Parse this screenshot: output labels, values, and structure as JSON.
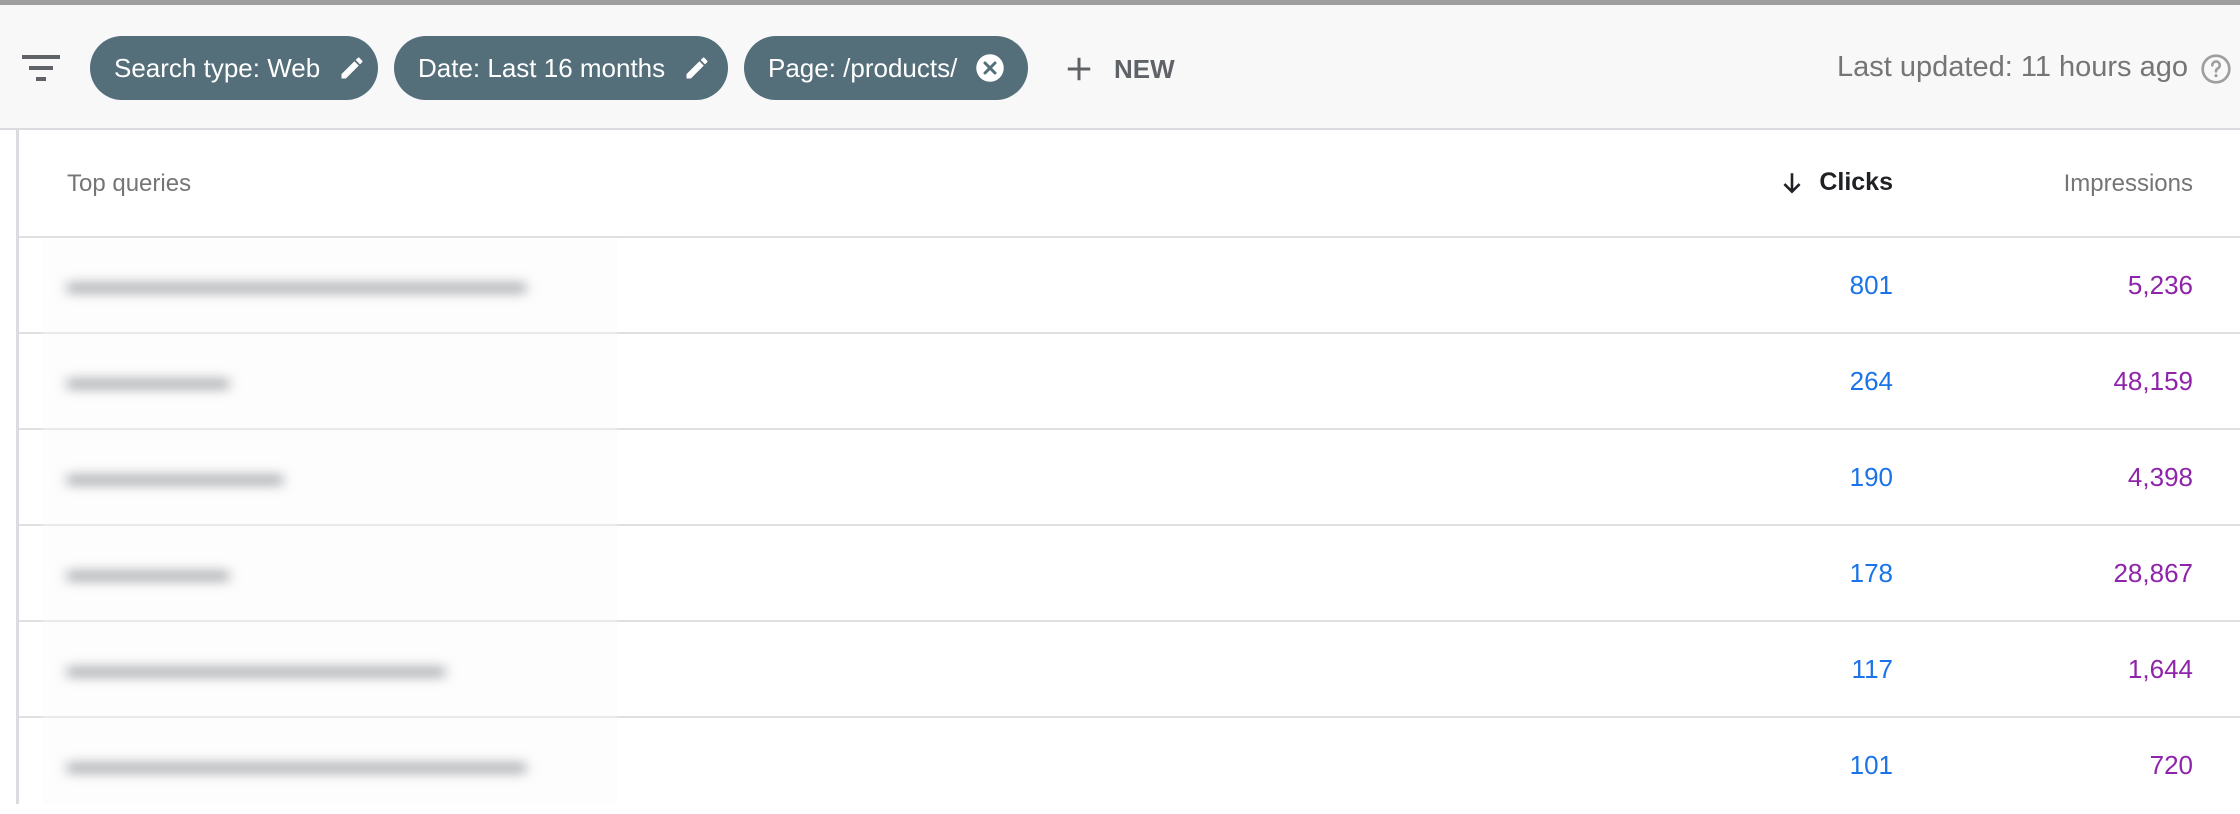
{
  "toolbar": {
    "filter_icon": "filter-list-icon",
    "chips": [
      {
        "label": "Search type: Web",
        "icon": "edit-pencil-icon"
      },
      {
        "label": "Date: Last 16 months",
        "icon": "edit-pencil-icon"
      },
      {
        "label": "Page: /products/",
        "icon": "close-circle-icon"
      }
    ],
    "new_label": "NEW",
    "new_icon": "plus-icon",
    "last_updated": "Last updated: 11 hours ago",
    "help_icon": "help-circle-icon"
  },
  "table": {
    "columns": {
      "query": "Top queries",
      "clicks": "Clicks",
      "impressions": "Impressions",
      "sort_icon": "arrow-down-icon"
    },
    "rows": [
      {
        "query": "",
        "clicks": "801",
        "impressions": "5,236"
      },
      {
        "query": "",
        "clicks": "264",
        "impressions": "48,159"
      },
      {
        "query": "",
        "clicks": "190",
        "impressions": "4,398"
      },
      {
        "query": "",
        "clicks": "178",
        "impressions": "28,867"
      },
      {
        "query": "",
        "clicks": "117",
        "impressions": "1,644"
      },
      {
        "query": "",
        "clicks": "101",
        "impressions": "720"
      }
    ]
  },
  "colors": {
    "chip_bg": "#546e7a",
    "clicks": "#1a73e8",
    "impressions": "#8e24aa"
  }
}
